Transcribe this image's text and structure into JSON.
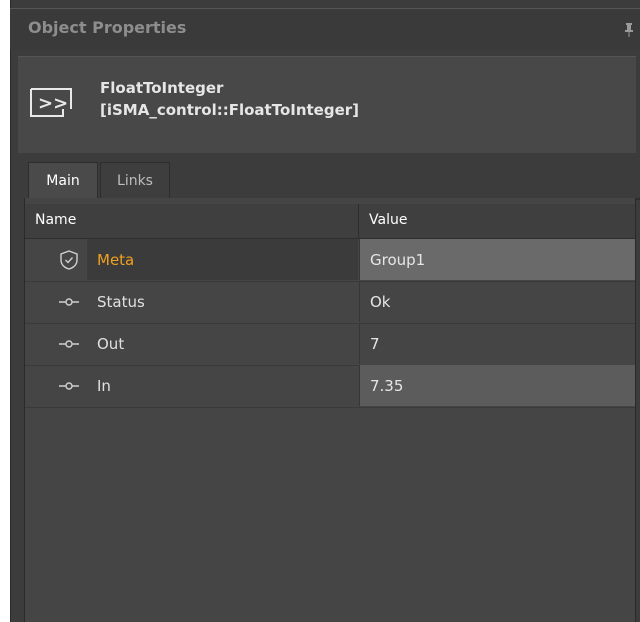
{
  "panel": {
    "title": "Object Properties",
    "pin_icon": "pin-icon"
  },
  "object": {
    "name": "FloatToInteger",
    "type": "[iSMA_control::FloatToInteger]",
    "icon": "component-icon"
  },
  "tabs": [
    {
      "label": "Main",
      "active": true
    },
    {
      "label": "Links",
      "active": false
    }
  ],
  "grid": {
    "columns": [
      "Name",
      "Value"
    ],
    "rows": [
      {
        "icon": "shield-icon",
        "name": "Meta",
        "value": "Group1"
      },
      {
        "icon": "slot-icon",
        "name": "Status",
        "value": "Ok"
      },
      {
        "icon": "slot-icon",
        "name": "Out",
        "value": "7"
      },
      {
        "icon": "slot-icon",
        "name": "In",
        "value": "7.35"
      }
    ]
  },
  "colors": {
    "meta_name": "#f0a020",
    "panel_bg": "#3c3c3c"
  }
}
